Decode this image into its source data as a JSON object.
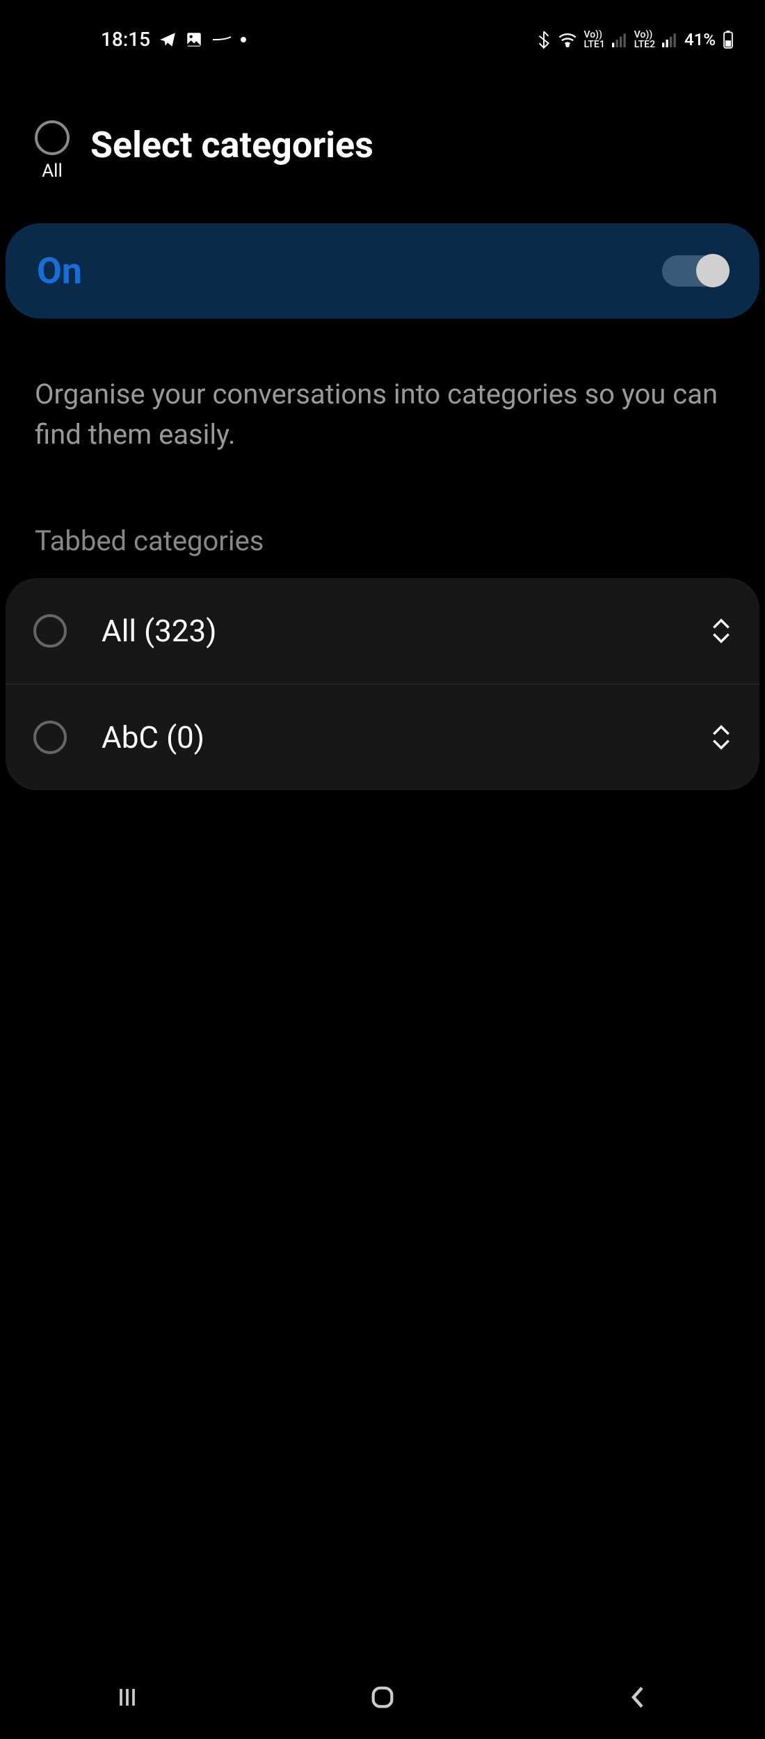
{
  "status_bar": {
    "time": "18:15",
    "battery": "41%",
    "lte1": "LTE1",
    "lte2": "LTE2"
  },
  "header": {
    "all_label": "All",
    "title": "Select categories"
  },
  "toggle": {
    "label": "On"
  },
  "description": "Organise your conversations into categories so you can find them easily.",
  "section_header": "Tabbed categories",
  "categories": [
    {
      "label": "All (323)"
    },
    {
      "label": "AbC (0)"
    }
  ]
}
